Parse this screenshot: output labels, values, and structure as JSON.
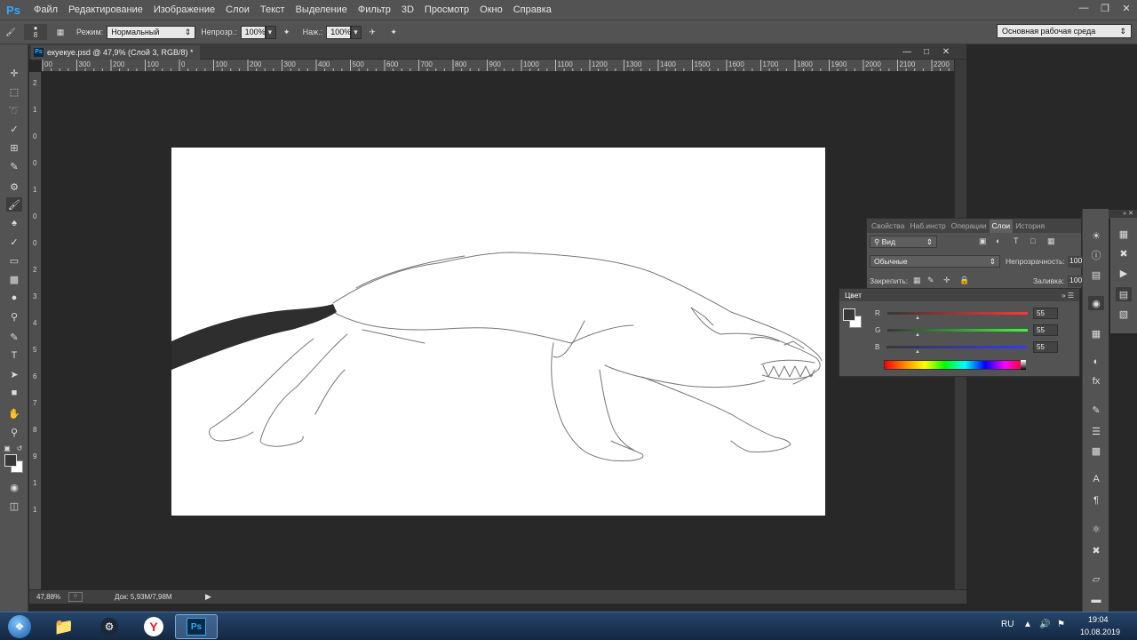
{
  "app": {
    "logo": "Ps"
  },
  "menu": [
    "Файл",
    "Редактирование",
    "Изображение",
    "Слои",
    "Текст",
    "Выделение",
    "Фильтр",
    "3D",
    "Просмотр",
    "Окно",
    "Справка"
  ],
  "options": {
    "brush_size": "8",
    "mode_label": "Режим:",
    "mode_value": "Нормальный",
    "opacity_label": "Непрозр.:",
    "opacity_value": "100%",
    "flow_label": "Наж.:",
    "flow_value": "100%",
    "workspace": "Основная рабочая среда"
  },
  "document": {
    "tab_title": "екуекуе.psd @ 47,9% (Слой 3, RGB/8) *",
    "zoom": "47,88%",
    "doc_size": "Док: 5,93M/7,98M"
  },
  "ruler_h": [
    "00",
    "300",
    "200",
    "100",
    "0",
    "100",
    "200",
    "300",
    "400",
    "500",
    "600",
    "700",
    "800",
    "900",
    "1000",
    "1100",
    "1200",
    "1300",
    "1400",
    "1500",
    "1600",
    "1700",
    "1800",
    "1900",
    "2000",
    "2100",
    "2200"
  ],
  "ruler_v": [
    "2",
    "1",
    "0",
    "0",
    "1",
    "0",
    "0",
    "2",
    "3",
    "4",
    "5",
    "6",
    "7",
    "8",
    "9",
    "1",
    "1"
  ],
  "layers_panel": {
    "tabs": [
      "Свойства",
      "Наб.инстр",
      "Операции",
      "Слои",
      "История"
    ],
    "active_tab": "Слои",
    "filter": "Вид",
    "blend": "Обычные",
    "opacity_label": "Непрозрачность:",
    "opacity_value": "100",
    "lock_label": "Закрепить:",
    "fill_label": "Заливка:",
    "fill_value": "100"
  },
  "color_panel": {
    "title": "Цвет",
    "r_label": "R",
    "r_value": "55",
    "g_label": "G",
    "g_value": "55",
    "b_label": "B",
    "b_value": "55",
    "fg_color": "#373737"
  },
  "taskbar": {
    "lang": "RU",
    "time": "19:04",
    "date": "10.08.2019"
  }
}
